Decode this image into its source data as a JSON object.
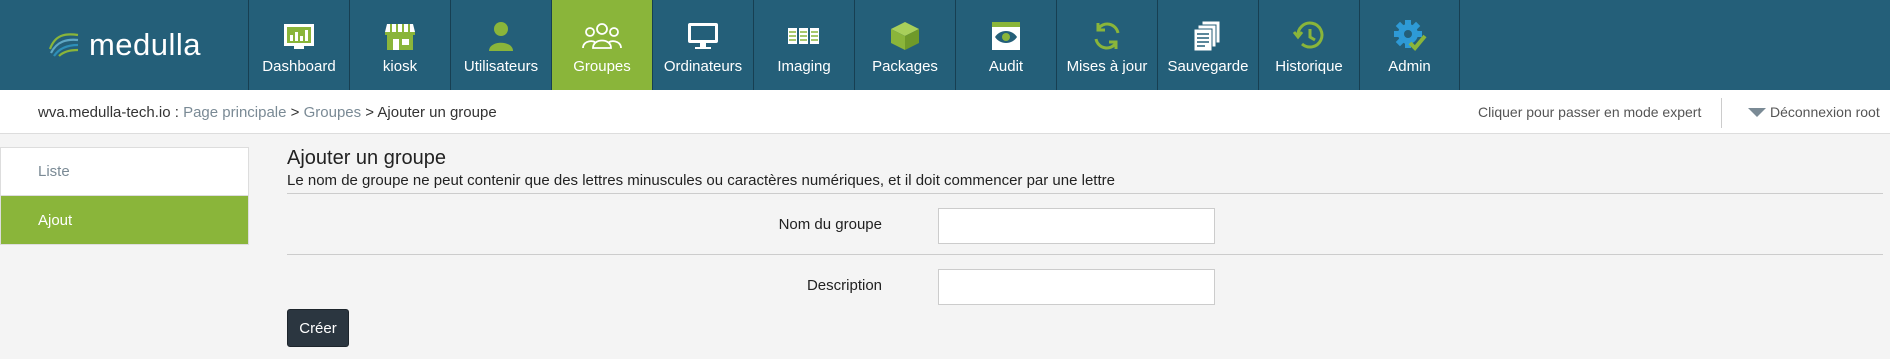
{
  "brand": {
    "logo_text": "medulla"
  },
  "nav": {
    "items": [
      {
        "label": "Dashboard",
        "icon": "dashboard-icon"
      },
      {
        "label": "kiosk",
        "icon": "kiosk-icon"
      },
      {
        "label": "Utilisateurs",
        "icon": "user-icon"
      },
      {
        "label": "Groupes",
        "icon": "groups-icon",
        "active": true
      },
      {
        "label": "Ordinateurs",
        "icon": "monitor-icon"
      },
      {
        "label": "Imaging",
        "icon": "imaging-icon"
      },
      {
        "label": "Packages",
        "icon": "packages-icon"
      },
      {
        "label": "Audit",
        "icon": "audit-icon"
      },
      {
        "label": "Mises à jour",
        "icon": "updates-icon"
      },
      {
        "label": "Sauvegarde",
        "icon": "backup-icon"
      },
      {
        "label": "Historique",
        "icon": "history-icon"
      },
      {
        "label": "Admin",
        "icon": "admin-gear-icon"
      }
    ]
  },
  "breadcrumb": {
    "host": "wva.medulla-tech.io",
    "sep1": " : ",
    "home": "Page principale",
    "sep2": " > ",
    "section": "Groupes",
    "sep3": " > ",
    "current": "Ajouter un groupe"
  },
  "header_right": {
    "expert": "Cliquer pour passer en mode expert",
    "logout": "Déconnexion root"
  },
  "sidebar": {
    "items": [
      {
        "label": "Liste"
      },
      {
        "label": "Ajout",
        "active": true
      }
    ]
  },
  "form": {
    "title": "Ajouter un groupe",
    "subtitle": "Le nom de groupe ne peut contenir que des lettres minuscules ou caractères numériques, et il doit commencer par une lettre",
    "name_label": "Nom du groupe",
    "name_value": "",
    "description_label": "Description",
    "description_value": "",
    "submit_label": "Créer"
  },
  "colors": {
    "topbar": "#245f79",
    "accent": "#8ab53a",
    "button": "#2b3640"
  }
}
